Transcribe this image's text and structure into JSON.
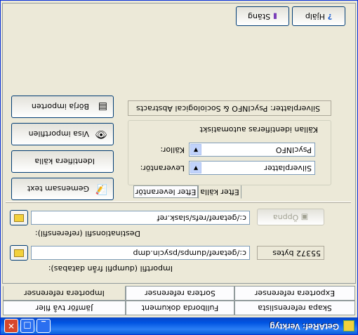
{
  "window": {
    "title": "GetARef: Verktyg",
    "buttons": [
      "_",
      "□",
      "✕"
    ]
  },
  "tabs_row1": [
    "Skapa referenslista",
    "Fullborda dokument",
    "Jämför två filer"
  ],
  "tabs_row2": [
    "Exportera referenser",
    "Sortera referenser",
    "Importera referenser"
  ],
  "import": {
    "file_label": "Importfil (dumpfil från databas):",
    "file_value": "c:/getaref/dumps/psycin.dmp",
    "size": "55372 bytes",
    "dest_label": "Destinationsfil (referensfil):",
    "dest_value": "c:/getaref/refs/slask.ref",
    "open_button": "Öppna"
  },
  "options": {
    "tab_source": "Efter källa",
    "tab_supplier": "Efter leverantör",
    "supplier_label": "Leverantör:",
    "supplier_value": "Silverplatter",
    "source_label": "Källor:",
    "source_value": "PsycINFO",
    "auto_text": "Källan identifieras automatiskt"
  },
  "status_text": "Silverplatter: PsycINFO & Sociological Abstracts",
  "side_buttons": {
    "common": "Gemensam text",
    "identify": "Identifiera källa",
    "show": "Visa importfilen",
    "start": "Börja importen"
  },
  "top_buttons": {
    "help": "Hjälp",
    "close": "Stäng"
  }
}
